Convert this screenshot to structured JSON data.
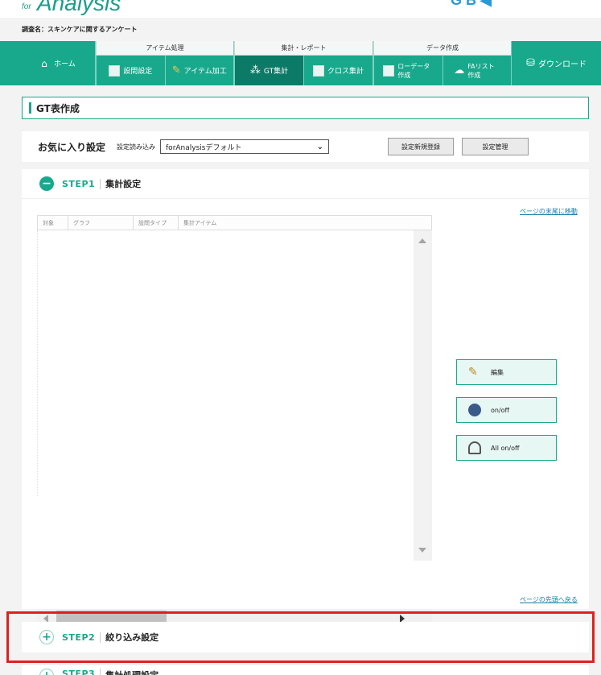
{
  "header": {
    "logo_for": "for",
    "logo_main": "Analysis",
    "survey_label": "調査名：スキンケアに関するアンケート"
  },
  "nav": {
    "home": "ホーム",
    "groups": [
      {
        "title": "アイテム処理",
        "items": [
          "設問設定",
          "アイテム加工"
        ]
      },
      {
        "title": "集計・レポート",
        "items": [
          "GT集計",
          "クロス集計"
        ]
      },
      {
        "title": "データ作成",
        "items": [
          "ローデータ作成",
          "FAリスト作成"
        ]
      }
    ],
    "download": "ダウンロード"
  },
  "page": {
    "title": "GT表作成"
  },
  "favorites": {
    "label": "お気に入り設定",
    "load_label": "設定読み込み",
    "selected": "forAnalysisデフォルト",
    "register_button": "設定新規登録",
    "manage_button": "設定管理"
  },
  "step1": {
    "step": "STEP1",
    "title": "集計設定",
    "link_bottom": "ページの末尾に移動",
    "link_top": "ページの先頭へ戻る",
    "columns": [
      "対象",
      "グラフ",
      "設問タイプ",
      "集計アイテム"
    ],
    "buttons": {
      "edit": "編集",
      "onoff": "on/off",
      "all_onoff": "All on/off"
    }
  },
  "step2": {
    "step": "STEP2",
    "title": "絞り込み設定"
  },
  "step3": {
    "step": "STEP3",
    "title": "集計処理設定"
  },
  "colors": {
    "accent": "#18a98c",
    "highlight": "#e02020"
  }
}
